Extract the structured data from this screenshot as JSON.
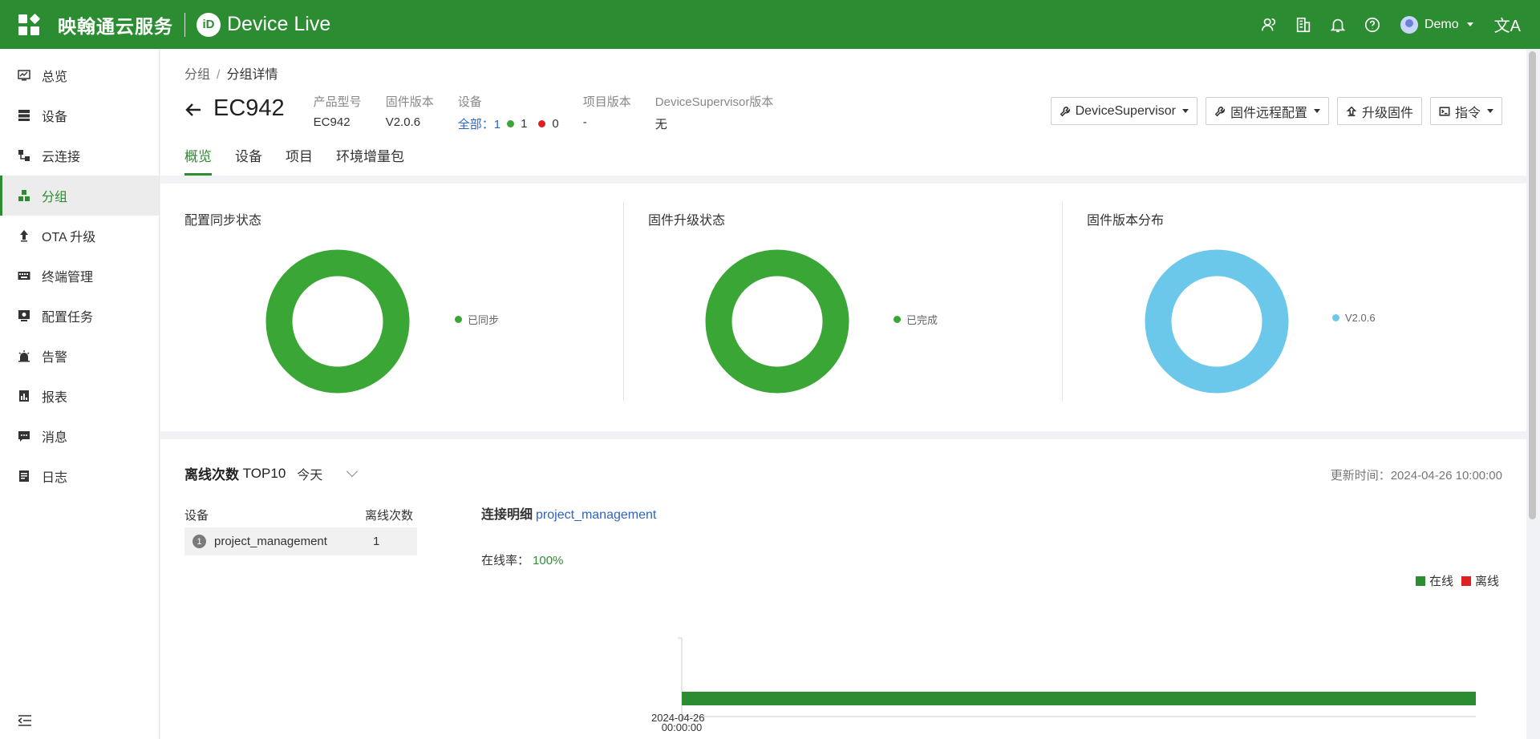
{
  "topbar": {
    "brand_cn": "映翰通云服务",
    "brand_logo": "iD",
    "brand_en": "Device Live",
    "user": "Demo",
    "lang_glyph": "文A",
    "icons": [
      "user-group-icon",
      "building-icon",
      "bell-icon",
      "help-icon",
      "language-icon"
    ]
  },
  "sidebar": {
    "items": [
      {
        "label": "总览",
        "icon": "overview-icon"
      },
      {
        "label": "设备",
        "icon": "device-icon"
      },
      {
        "label": "云连接",
        "icon": "cloud-connect-icon"
      },
      {
        "label": "分组",
        "icon": "group-icon",
        "active": true
      },
      {
        "label": "OTA 升级",
        "icon": "upload-icon"
      },
      {
        "label": "终端管理",
        "icon": "keyboard-icon"
      },
      {
        "label": "配置任务",
        "icon": "config-task-icon"
      },
      {
        "label": "告警",
        "icon": "alarm-icon"
      },
      {
        "label": "报表",
        "icon": "report-icon"
      },
      {
        "label": "消息",
        "icon": "message-icon"
      },
      {
        "label": "日志",
        "icon": "log-icon"
      }
    ]
  },
  "breadcrumb": {
    "parent": "分组",
    "separator": "/",
    "current": "分组详情"
  },
  "header": {
    "title": "EC942",
    "meta": {
      "model_label": "产品型号",
      "model_value": "EC942",
      "firmware_label": "固件版本",
      "firmware_value": "V2.0.6",
      "devices_label": "设备",
      "devices_all": "全部：",
      "devices_total": "1",
      "devices_online": "1",
      "devices_offline": "0",
      "project_label": "项目版本",
      "project_value": "-",
      "supervisor_label": "DeviceSupervisor版本",
      "supervisor_value": "无"
    },
    "actions": {
      "device_supervisor": "DeviceSupervisor",
      "remote_config": "固件远程配置",
      "upgrade": "升级固件",
      "command": "指令"
    },
    "tabs": [
      "概览",
      "设备",
      "项目",
      "环境增量包"
    ]
  },
  "stats": {
    "config_sync": {
      "title": "配置同步状态",
      "legend": "已同步",
      "color": "#3aa635",
      "fraction": 1.0
    },
    "firmware_upgrade": {
      "title": "固件升级状态",
      "legend": "已完成",
      "color": "#3aa635",
      "fraction": 1.0
    },
    "firmware_dist": {
      "title": "固件版本分布",
      "legend": "V2.0.6",
      "color": "#6cc8eb",
      "fraction": 1.0
    }
  },
  "offline": {
    "title_bold": "离线次数",
    "title_rest": "TOP10",
    "range": "今天",
    "updated_label": "更新时间：",
    "updated_value": "2024-04-26 10:00:00",
    "col_device": "设备",
    "col_count": "离线次数",
    "rows": [
      {
        "rank": "1",
        "name": "project_management",
        "count": "1"
      }
    ],
    "conn_label": "连接明细",
    "conn_device": "project_management",
    "online_rate_label": "在线率：",
    "online_rate_value": "100%",
    "legend_online": "在线",
    "legend_offline": "离线",
    "color_online": "#2c8c32",
    "color_offline": "#e02020",
    "axis_time": "00:00:00",
    "axis_date": "2024-04-26",
    "offline_marker_fraction": 0.847
  }
}
